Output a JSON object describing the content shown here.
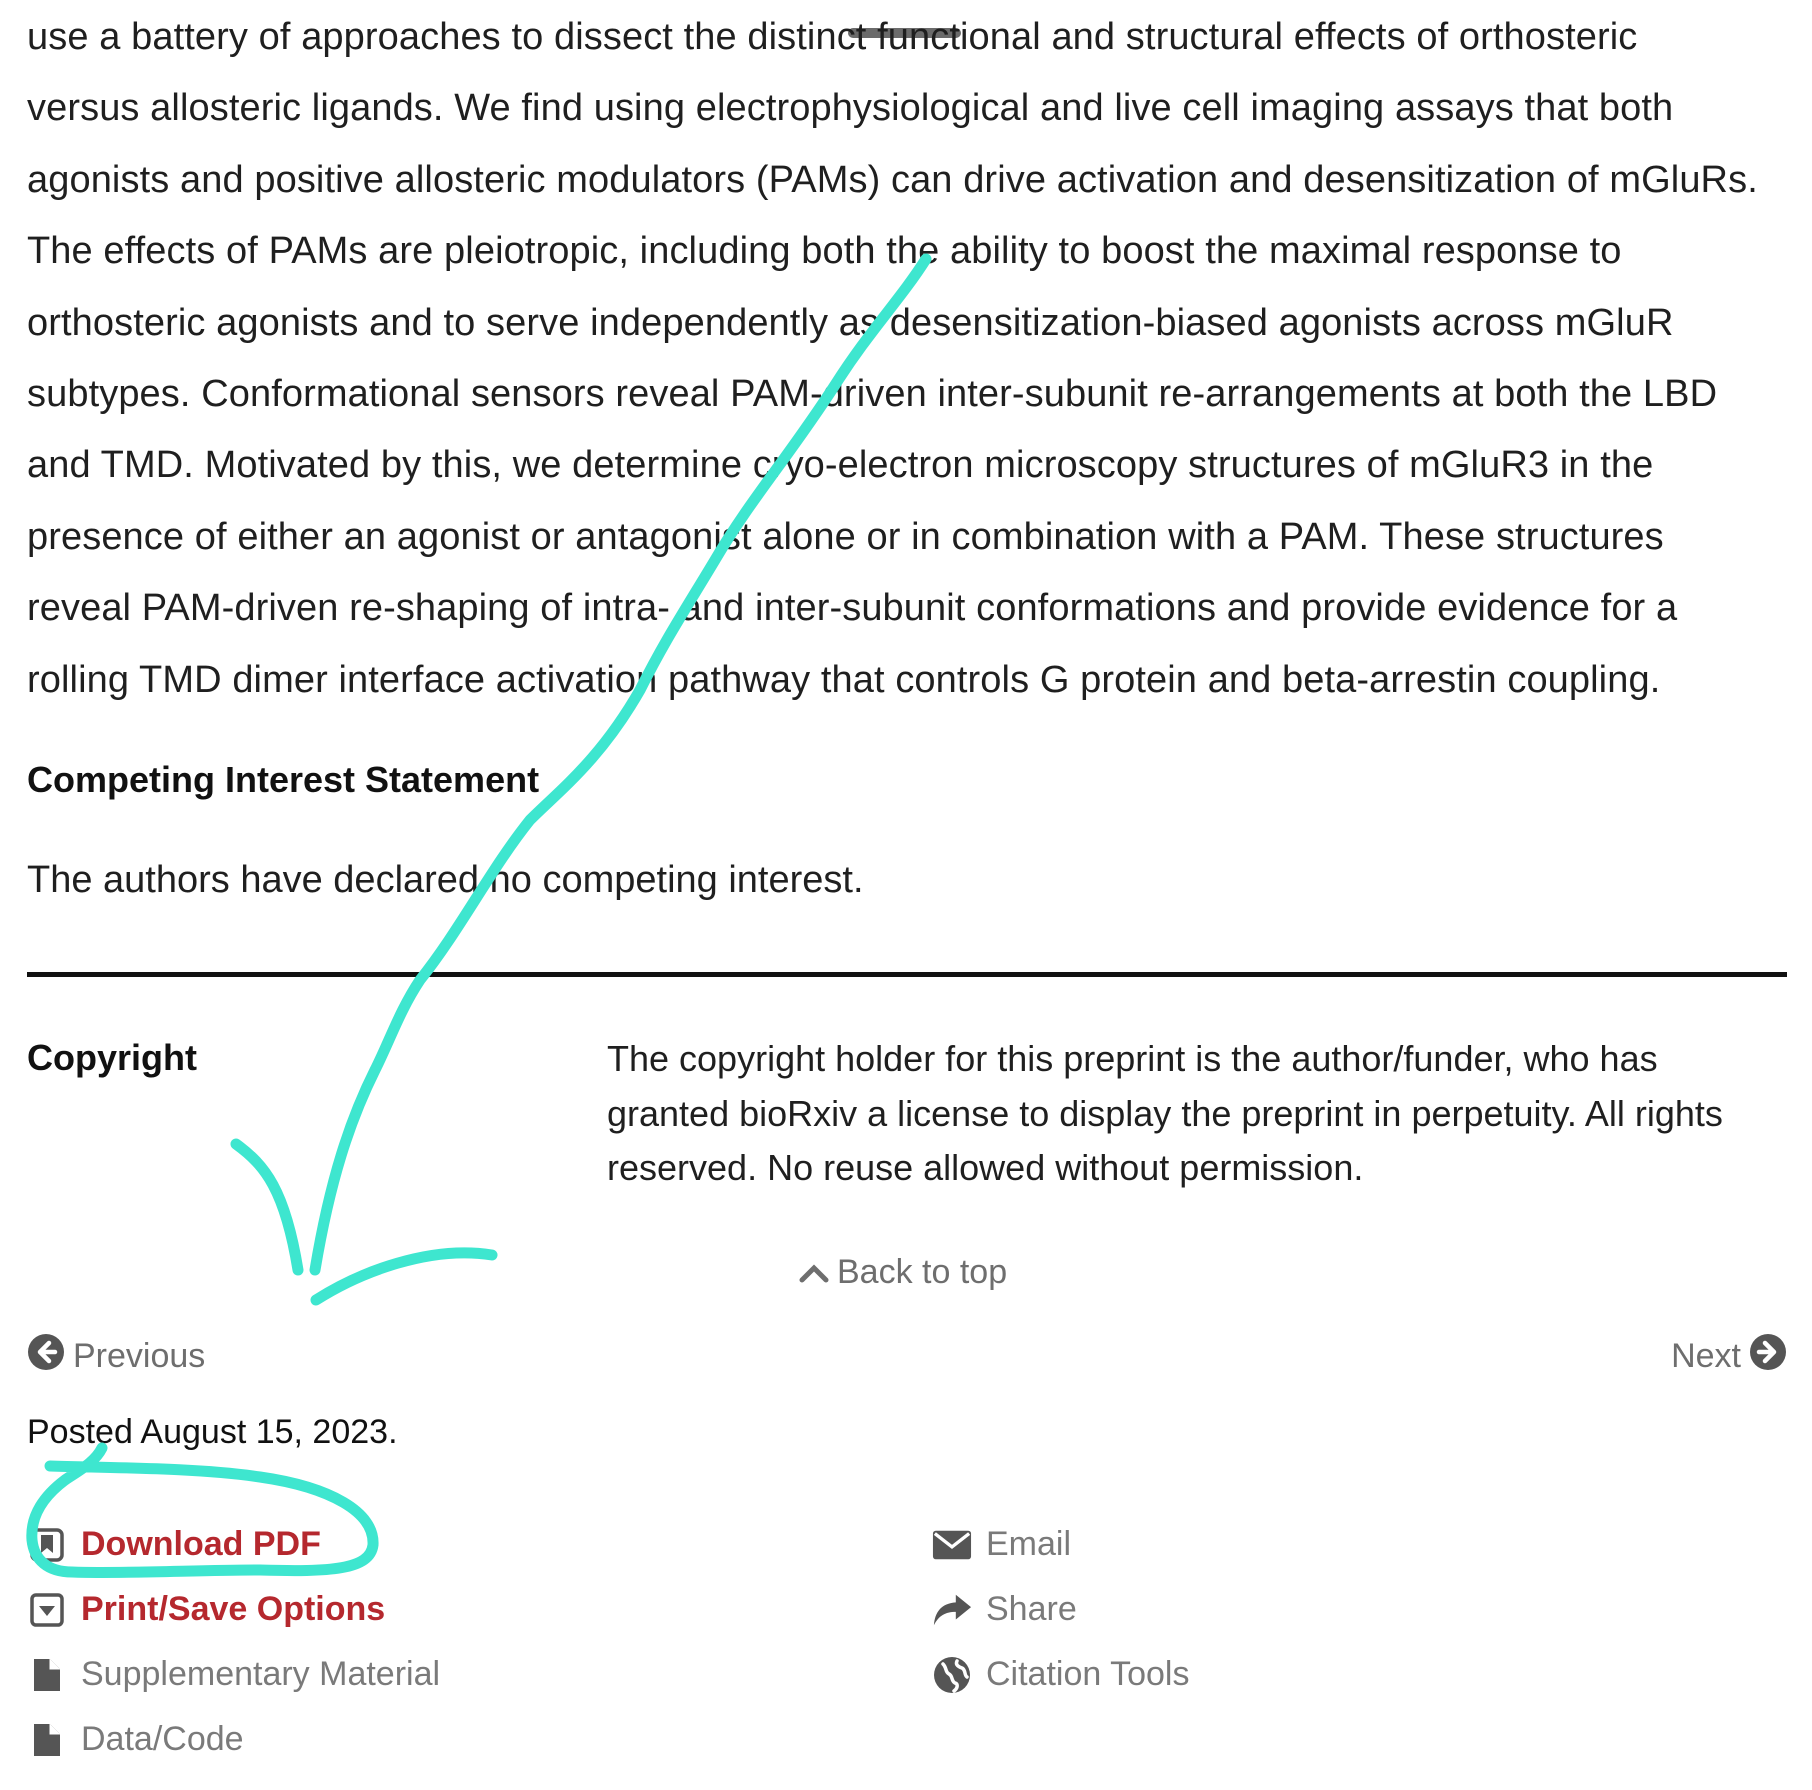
{
  "abstract": {
    "lines": [
      "use a battery of approaches to dissect the distinct functional and structural effects of orthosteric",
      "versus allosteric ligands. We find using electrophysiological and live cell imaging assays that both",
      "agonists and positive allosteric modulators (PAMs) can drive activation and desensitization of mGluRs.",
      "The effects of PAMs are pleiotropic, including both the ability to boost the maximal response to",
      "orthosteric agonists and to serve independently as desensitization-biased agonists across mGluR",
      "subtypes. Conformational sensors reveal PAM-driven inter-subunit re-arrangements at both the LBD",
      "and TMD. Motivated by this, we determine cryo-electron microscopy structures of mGluR3 in the",
      "presence of either an agonist or antagonist alone or in combination with a PAM. These structures",
      "reveal PAM-driven re-shaping of intra- and inter-subunit conformations and provide evidence for a",
      "rolling TMD dimer interface activation pathway that controls G protein and beta-arrestin coupling."
    ]
  },
  "competing": {
    "heading": "Competing Interest Statement",
    "text": "The authors have declared no competing interest."
  },
  "copyright": {
    "label": "Copyright",
    "text": "The copyright holder for this preprint is the author/funder, who has granted bioRxiv a license to display the preprint in perpetuity. All rights reserved. No reuse allowed without permission."
  },
  "nav": {
    "back_to_top": "Back to top",
    "previous": "Previous",
    "next": "Next"
  },
  "posted": "Posted August 15, 2023.",
  "actions": {
    "left": [
      {
        "label": "Download PDF",
        "icon": "bookmark-icon"
      },
      {
        "label": "Print/Save Options",
        "icon": "dropdown-box-icon"
      },
      {
        "label": "Supplementary Material",
        "icon": "file-icon"
      },
      {
        "label": "Data/Code",
        "icon": "file-icon"
      }
    ],
    "right": [
      {
        "label": "Email",
        "icon": "envelope-icon"
      },
      {
        "label": "Share",
        "icon": "share-arrow-icon"
      },
      {
        "label": "Citation Tools",
        "icon": "globe-icon"
      }
    ]
  },
  "colors": {
    "link_red": "#b5282e",
    "muted_grey": "#7a7a7a",
    "annotation": "#3ee6cf"
  }
}
